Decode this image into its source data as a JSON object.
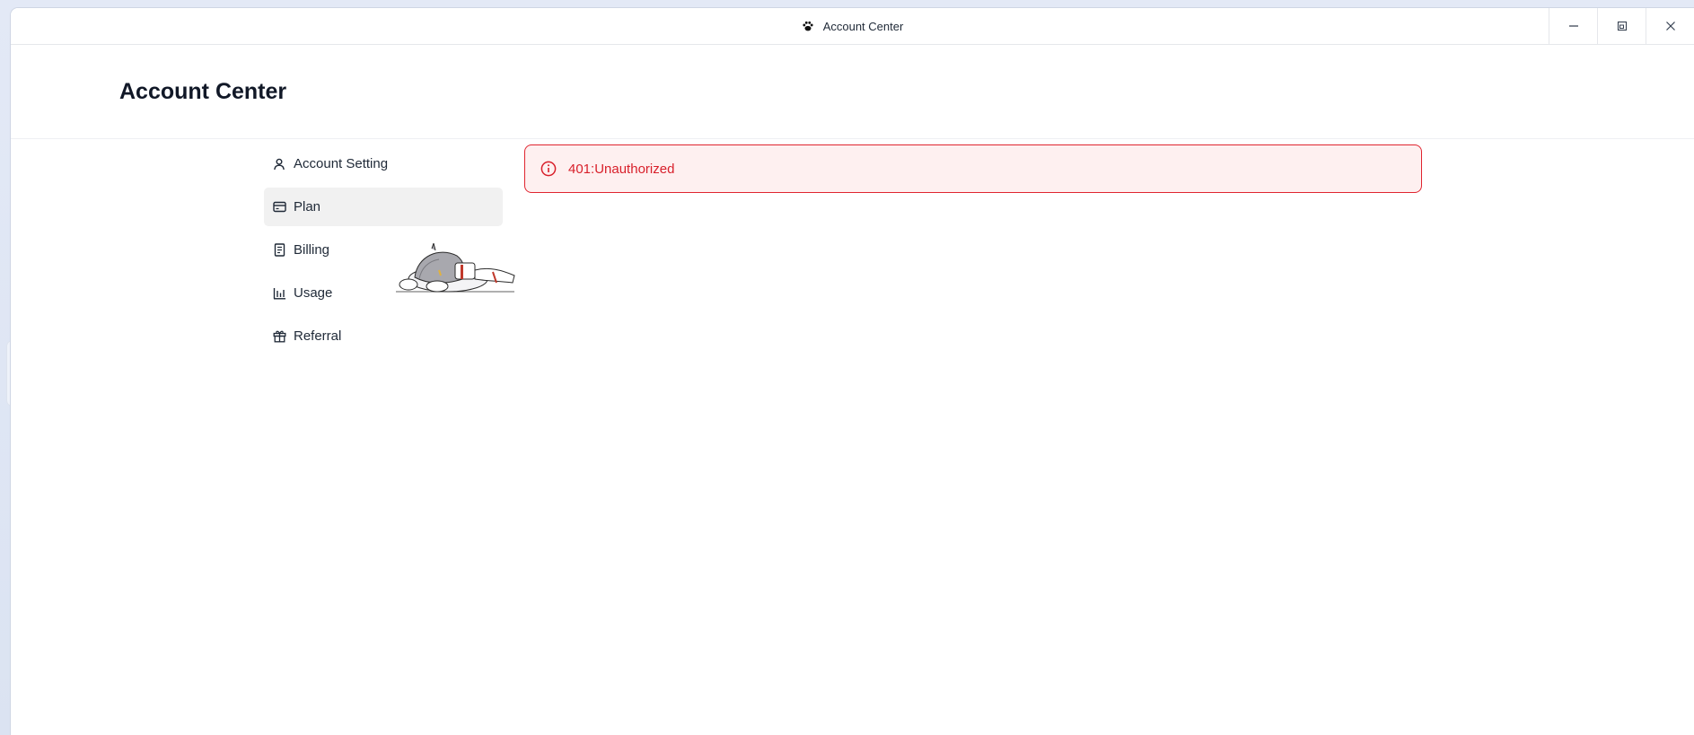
{
  "window": {
    "title": "Account Center",
    "icon": "paw-icon",
    "controls": [
      "minimize-icon",
      "restore-icon",
      "close-icon"
    ]
  },
  "page": {
    "title": "Account Center"
  },
  "nav": {
    "items": [
      {
        "label": "Account Setting",
        "icon": "user-icon",
        "active": false
      },
      {
        "label": "Plan",
        "icon": "credit-card-icon",
        "active": true
      },
      {
        "label": "Billing",
        "icon": "document-icon",
        "active": false
      },
      {
        "label": "Usage",
        "icon": "bar-chart-icon",
        "active": false
      },
      {
        "label": "Referral",
        "icon": "gift-icon",
        "active": false
      }
    ]
  },
  "alert": {
    "message": "401:Unauthorized",
    "icon": "info-circle-icon",
    "color": "#d81f2a",
    "background": "#fef0f0"
  },
  "colors": {
    "accent_error": "#e0242f",
    "active_nav_bg": "#f1f1f1"
  }
}
